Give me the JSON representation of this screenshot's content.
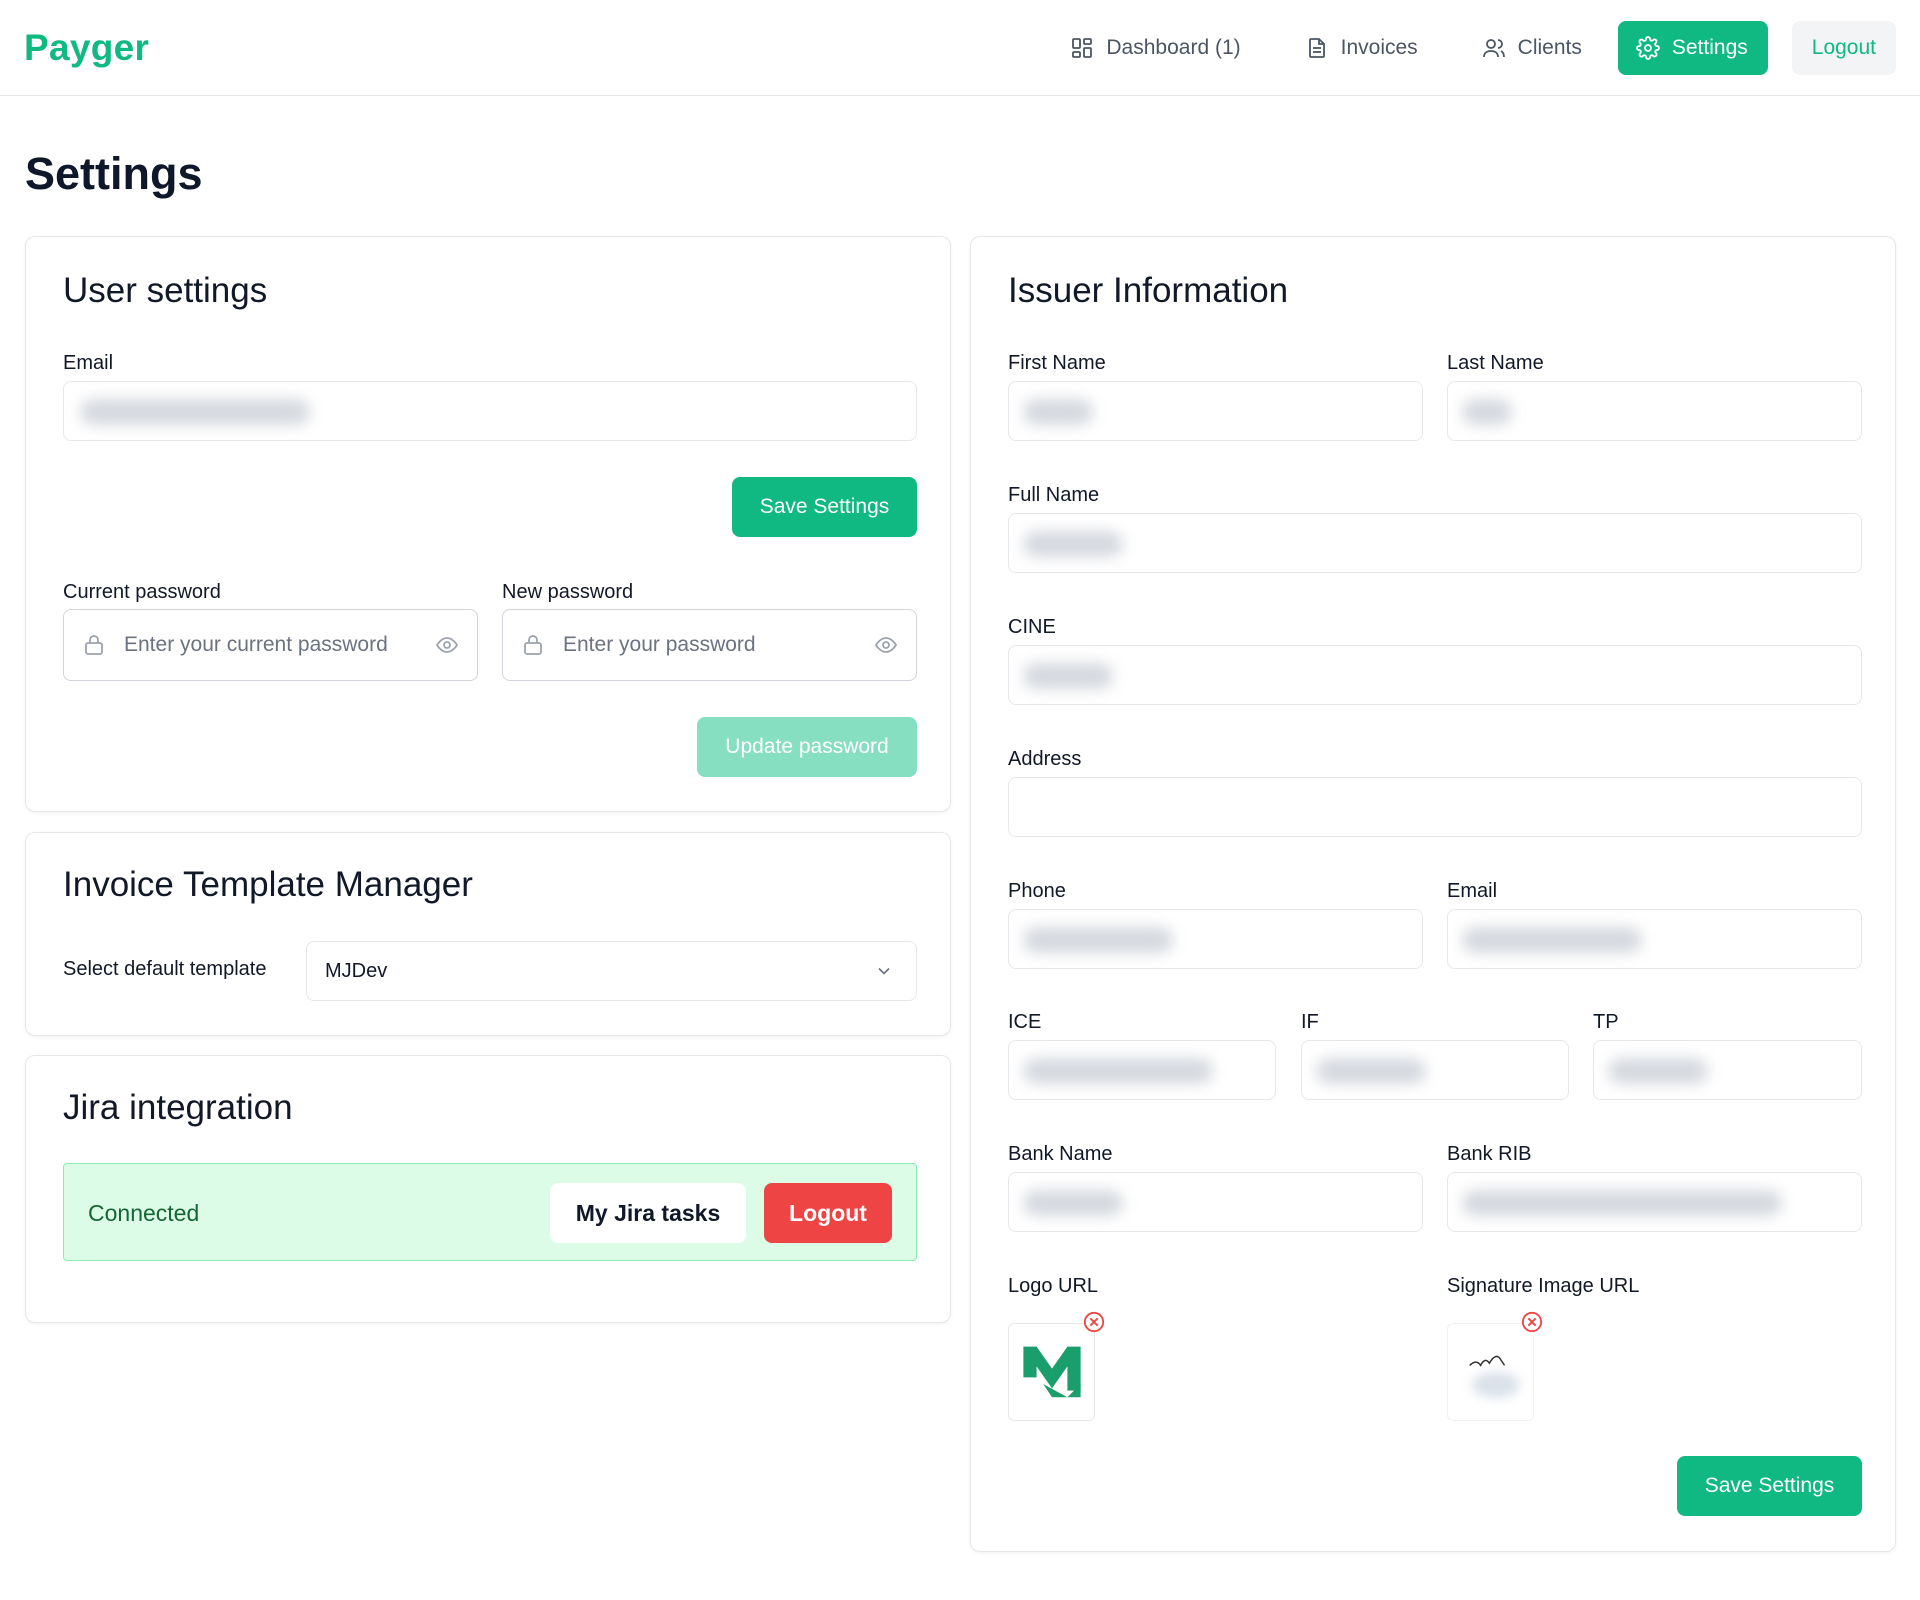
{
  "brand": "Payger",
  "nav": {
    "dashboard": "Dashboard (1)",
    "invoices": "Invoices",
    "clients": "Clients",
    "settings": "Settings",
    "logout": "Logout"
  },
  "page_title": "Settings",
  "user_settings": {
    "title": "User settings",
    "email_label": "Email",
    "save_button": "Save Settings",
    "current_password_label": "Current password",
    "current_password_placeholder": "Enter your current password",
    "new_password_label": "New password",
    "new_password_placeholder": "Enter your password",
    "update_password_button": "Update password"
  },
  "template_manager": {
    "title": "Invoice Template Manager",
    "select_label": "Select default template",
    "selected_template": "MJDev"
  },
  "jira": {
    "title": "Jira integration",
    "status": "Connected",
    "tasks_button": "My Jira tasks",
    "logout_button": "Logout"
  },
  "issuer": {
    "title": "Issuer Information",
    "first_name_label": "First Name",
    "last_name_label": "Last Name",
    "full_name_label": "Full Name",
    "cine_label": "CINE",
    "address_label": "Address",
    "phone_label": "Phone",
    "email_label": "Email",
    "ice_label": "ICE",
    "if_label": "IF",
    "tp_label": "TP",
    "bank_name_label": "Bank Name",
    "bank_rib_label": "Bank RIB",
    "logo_label": "Logo URL",
    "signature_label": "Signature Image URL",
    "save_button": "Save Settings"
  },
  "colors": {
    "accent": "#10b981",
    "danger": "#ef4444",
    "connected_bg": "#dcfce7"
  },
  "icons": [
    "dashboard-icon",
    "document-icon",
    "users-icon",
    "gear-icon",
    "lock-icon",
    "eye-icon",
    "chevron-down-icon",
    "remove-icon"
  ]
}
